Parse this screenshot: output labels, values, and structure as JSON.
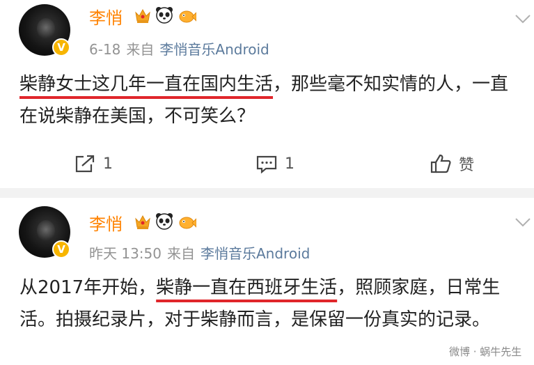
{
  "posts": [
    {
      "username": "李悄",
      "time": "6-18",
      "via": "来自",
      "source": "李悄音乐Android",
      "text_underlined": "柴静女士这几年一直在国内生活",
      "text_rest": "，那些毫不知实情的人，一直在说柴静在美国，不可笑么？",
      "actions": {
        "repost": "1",
        "comment": "1",
        "like": "赞"
      }
    },
    {
      "username": "李悄",
      "time": "昨天 13:50",
      "via": "来自",
      "source": "李悄音乐Android",
      "text_before": "从2017年开始，",
      "text_underlined": "柴静一直在西班牙生活",
      "text_after": "，照顾家庭，日常生活。拍摄纪录片，对于柴静而言，是保留一份真实的记录。"
    }
  ],
  "watermark": "微博 · 蜗牛先生",
  "colors": {
    "username": "#ff8200",
    "source": "#5b7a9c",
    "underline": "#e0262b",
    "verified": "#f7b500"
  },
  "icons": [
    "crown-badge-icon",
    "panda-icon",
    "fish-icon",
    "chevron-down-icon",
    "repost-icon",
    "comment-icon",
    "like-icon"
  ]
}
